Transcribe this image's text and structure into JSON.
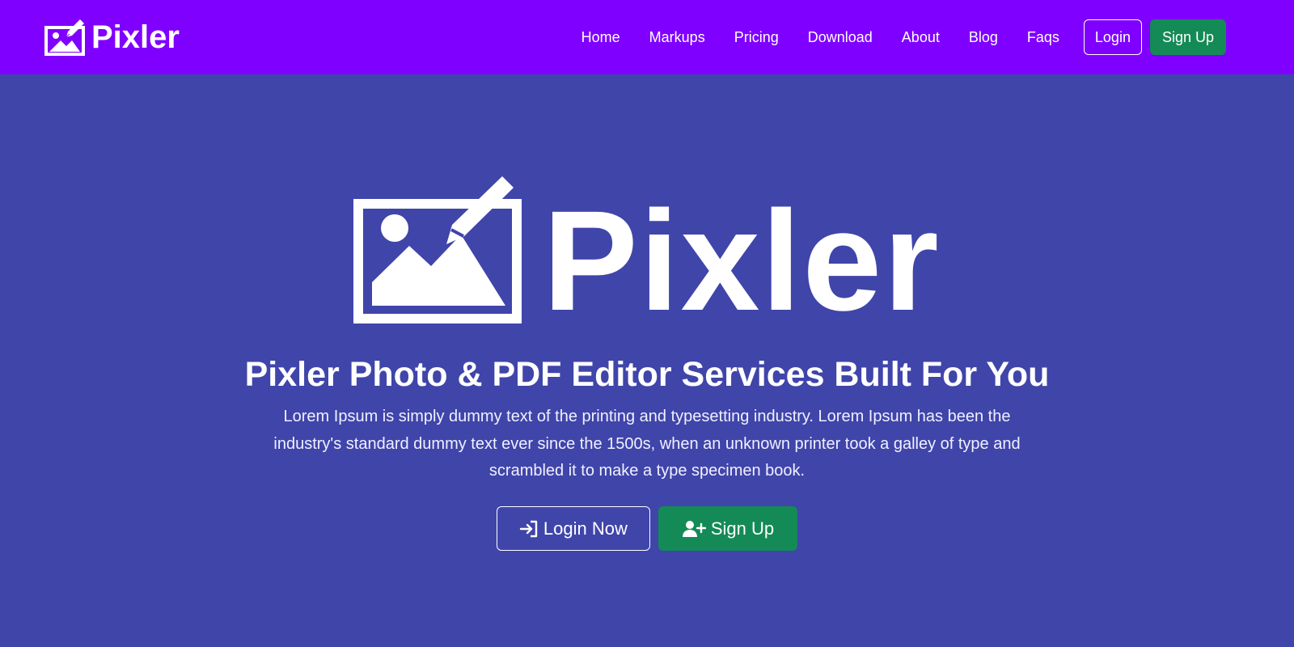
{
  "header": {
    "brand": "Pixler",
    "brand_icon": "image-edit-icon",
    "nav": [
      {
        "label": "Home"
      },
      {
        "label": "Markups"
      },
      {
        "label": "Pricing"
      },
      {
        "label": "Download"
      },
      {
        "label": "About"
      },
      {
        "label": "Blog"
      },
      {
        "label": "Faqs"
      }
    ],
    "login_label": "Login",
    "signup_label": "Sign Up",
    "background": "#8000ff"
  },
  "hero": {
    "logo_text": "Pixler",
    "logo_icon": "image-edit-icon",
    "title": "Pixler Photo & PDF Editor Services Built For You",
    "description": "Lorem Ipsum is simply dummy text of the printing and typesetting industry. Lorem Ipsum has been the industry's standard dummy text ever since the 1500s, when an unknown printer took a galley of type and scrambled it to make a type specimen book.",
    "login_label": "Login Now",
    "login_icon": "sign-in-icon",
    "signup_label": "Sign Up",
    "signup_icon": "user-plus-icon",
    "background": "#4045aa"
  },
  "colors": {
    "primary_nav": "#8000ff",
    "hero_bg": "#4045aa",
    "success": "#148a56"
  }
}
